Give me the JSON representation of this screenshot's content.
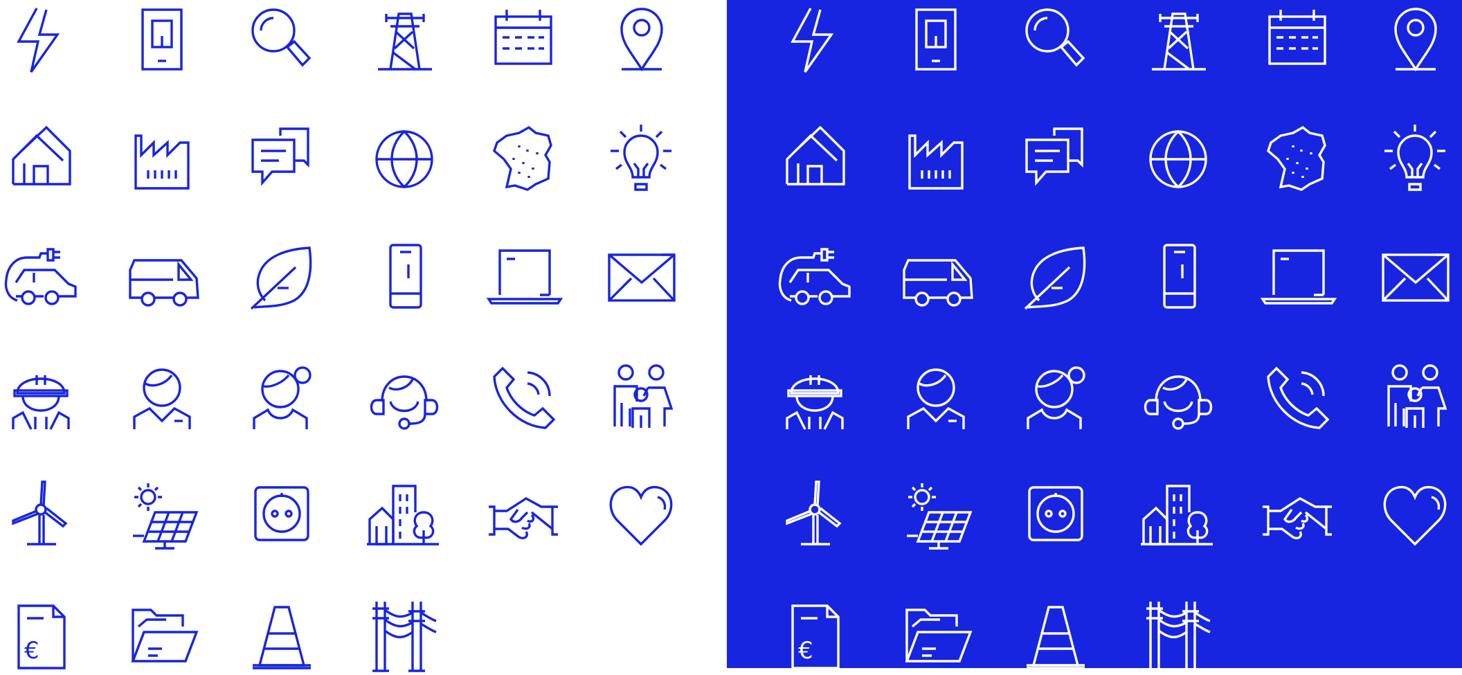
{
  "palette": {
    "light_background": "#ffffff",
    "dark_background": "#1725e0",
    "light_stroke": "#1725e0",
    "dark_stroke": "#ffffff"
  },
  "panels": [
    {
      "theme": "light"
    },
    {
      "theme": "dark"
    }
  ],
  "icons": [
    "lightning-icon",
    "smart-meter-icon",
    "magnifier-icon",
    "pylon-icon",
    "calendar-icon",
    "map-pin-icon",
    "house-icon",
    "factory-icon",
    "chat-bubbles-icon",
    "globe-icon",
    "france-map-icon",
    "lightbulb-icon",
    "electric-car-icon",
    "van-icon",
    "leaf-icon",
    "smartphone-icon",
    "laptop-icon",
    "envelope-icon",
    "technician-icon",
    "man-icon",
    "woman-icon",
    "headset-agent-icon",
    "phone-call-icon",
    "family-icon",
    "wind-turbine-icon",
    "solar-panel-icon",
    "power-socket-icon",
    "city-buildings-icon",
    "handshake-icon",
    "heart-icon",
    "euro-bill-icon",
    "folder-icon",
    "traffic-cone-icon",
    "power-line-icon"
  ],
  "euro_symbol": "€"
}
